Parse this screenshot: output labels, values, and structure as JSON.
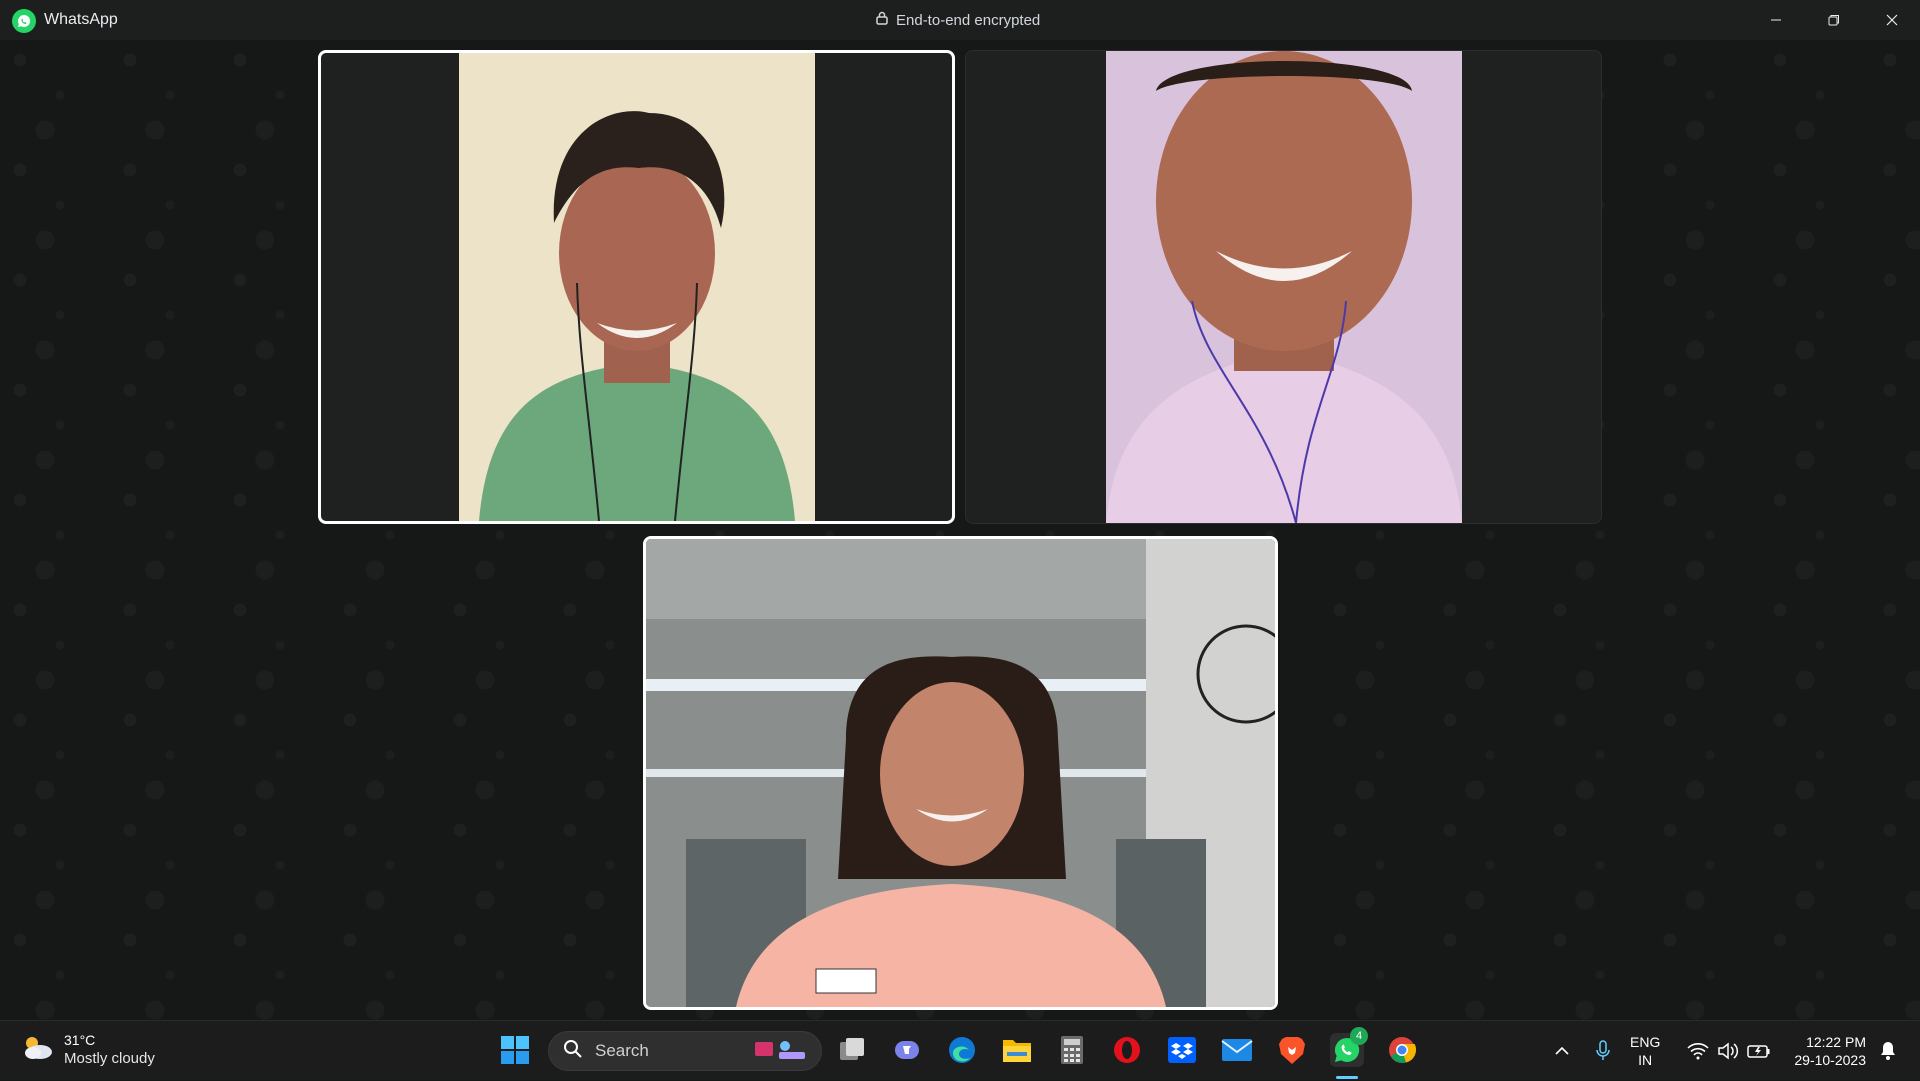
{
  "window": {
    "app_name": "WhatsApp",
    "encryption_label": "End-to-end encrypted",
    "controls": [
      "minimize",
      "restore",
      "close"
    ]
  },
  "call": {
    "participants": [
      {
        "id": "participant-1",
        "state": "active-speaker",
        "shirt_color": "#6da87c",
        "bg_color": "#ece3c8"
      },
      {
        "id": "participant-2",
        "state": "normal",
        "shirt_color": "#e8cde6",
        "bg_color": "#d9c3dc"
      },
      {
        "id": "participant-3",
        "state": "self-view",
        "shirt_color": "#f6b4a4",
        "bg_color": "#8c9190"
      }
    ]
  },
  "taskbar": {
    "weather": {
      "temp": "31°C",
      "condition": "Mostly cloudy"
    },
    "search_placeholder": "Search",
    "apps": [
      {
        "name": "start-icon"
      },
      {
        "name": "search"
      },
      {
        "name": "task-view-icon"
      },
      {
        "name": "teams-icon"
      },
      {
        "name": "edge-icon"
      },
      {
        "name": "file-explorer-icon"
      },
      {
        "name": "calculator-icon"
      },
      {
        "name": "opera-icon"
      },
      {
        "name": "dropbox-icon"
      },
      {
        "name": "mail-icon"
      },
      {
        "name": "brave-icon"
      },
      {
        "name": "whatsapp-icon"
      },
      {
        "name": "chrome-icon"
      }
    ],
    "whatsapp_badge": "4",
    "language": {
      "line1": "ENG",
      "line2": "IN"
    },
    "clock": {
      "time": "12:22 PM",
      "date": "29-10-2023"
    }
  }
}
